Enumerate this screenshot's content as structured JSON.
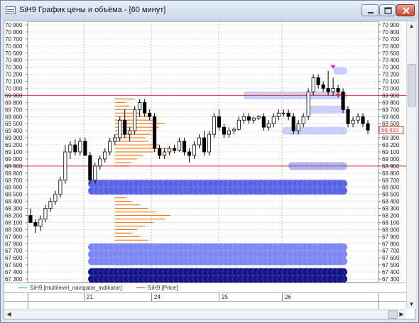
{
  "window": {
    "title": "SiH9 График цены и объёма - [60 минут]",
    "buttons": [
      "minimize",
      "maximize",
      "close"
    ]
  },
  "price_axis": {
    "labels": [
      "70 900",
      "70 800",
      "70 700",
      "70 600",
      "70 500",
      "70 400",
      "70 300",
      "70 200",
      "70 100",
      "70 000",
      "69 900",
      "69 800",
      "69 700",
      "69 600",
      "69 500",
      "69 400",
      "69 300",
      "69 200",
      "69 100",
      "69 000",
      "68 900",
      "68 800",
      "68 700",
      "68 600",
      "68 500",
      "68 400",
      "68 300",
      "68 200",
      "68 100",
      "68 000",
      "67 900",
      "67 800",
      "67 700",
      "67 600",
      "67 500",
      "67 400",
      "67 300"
    ],
    "current_price_label": "69 410",
    "current_price": 69410
  },
  "legend": {
    "items": [
      {
        "label": "SiH9 [multilevel_navigator_indikator]",
        "color": "#2bb3c9"
      },
      {
        "label": "SiH9 [Price]",
        "color": "#d43a2a"
      }
    ]
  },
  "dates": [
    "21",
    "24",
    "25",
    "26"
  ],
  "chart_data": {
    "type": "candlestick",
    "y_range": [
      67250,
      70950
    ],
    "candles": [
      {
        "o": 68200,
        "h": 68300,
        "l": 68100,
        "c": 68100
      },
      {
        "o": 68100,
        "h": 68150,
        "l": 67950,
        "c": 68050
      },
      {
        "o": 68050,
        "h": 68200,
        "l": 67980,
        "c": 68150
      },
      {
        "o": 68150,
        "h": 68350,
        "l": 68100,
        "c": 68300
      },
      {
        "o": 68300,
        "h": 68450,
        "l": 68250,
        "c": 68400
      },
      {
        "o": 68400,
        "h": 68550,
        "l": 68350,
        "c": 68500
      },
      {
        "o": 68500,
        "h": 68750,
        "l": 68450,
        "c": 68700
      },
      {
        "o": 68700,
        "h": 69200,
        "l": 68650,
        "c": 69100
      },
      {
        "o": 69100,
        "h": 69250,
        "l": 69000,
        "c": 69200
      },
      {
        "o": 69200,
        "h": 69280,
        "l": 69050,
        "c": 69100
      },
      {
        "o": 69100,
        "h": 69300,
        "l": 69050,
        "c": 69250
      },
      {
        "o": 69250,
        "h": 69300,
        "l": 69050,
        "c": 69050
      },
      {
        "o": 69050,
        "h": 69100,
        "l": 68650,
        "c": 68700
      },
      {
        "o": 68700,
        "h": 68950,
        "l": 68650,
        "c": 68900
      },
      {
        "o": 68900,
        "h": 69050,
        "l": 68850,
        "c": 69000
      },
      {
        "o": 69000,
        "h": 69150,
        "l": 68950,
        "c": 69100
      },
      {
        "o": 69100,
        "h": 69300,
        "l": 69050,
        "c": 69250
      },
      {
        "o": 69250,
        "h": 69350,
        "l": 69200,
        "c": 69300
      },
      {
        "o": 69300,
        "h": 69600,
        "l": 69250,
        "c": 69550
      },
      {
        "o": 69550,
        "h": 69700,
        "l": 69300,
        "c": 69350
      },
      {
        "o": 69350,
        "h": 69450,
        "l": 69250,
        "c": 69400
      },
      {
        "o": 69400,
        "h": 69750,
        "l": 69350,
        "c": 69700
      },
      {
        "o": 69700,
        "h": 69850,
        "l": 69600,
        "c": 69800
      },
      {
        "o": 69800,
        "h": 69850,
        "l": 69600,
        "c": 69650
      },
      {
        "o": 69650,
        "h": 69700,
        "l": 69550,
        "c": 69600
      },
      {
        "o": 69600,
        "h": 69650,
        "l": 69100,
        "c": 69150
      },
      {
        "o": 69150,
        "h": 69200,
        "l": 69000,
        "c": 69050
      },
      {
        "o": 69050,
        "h": 69150,
        "l": 69000,
        "c": 69100
      },
      {
        "o": 69100,
        "h": 69180,
        "l": 69050,
        "c": 69150
      },
      {
        "o": 69150,
        "h": 69200,
        "l": 69080,
        "c": 69120
      },
      {
        "o": 69120,
        "h": 69300,
        "l": 69100,
        "c": 69250
      },
      {
        "o": 69250,
        "h": 69300,
        "l": 69050,
        "c": 69100
      },
      {
        "o": 69100,
        "h": 69150,
        "l": 68950,
        "c": 69050
      },
      {
        "o": 69050,
        "h": 69250,
        "l": 69000,
        "c": 69200
      },
      {
        "o": 69200,
        "h": 69350,
        "l": 69150,
        "c": 69300
      },
      {
        "o": 69300,
        "h": 69400,
        "l": 69050,
        "c": 69100
      },
      {
        "o": 69100,
        "h": 69400,
        "l": 69050,
        "c": 69350
      },
      {
        "o": 69350,
        "h": 69650,
        "l": 69300,
        "c": 69600
      },
      {
        "o": 69600,
        "h": 69700,
        "l": 69400,
        "c": 69450
      },
      {
        "o": 69450,
        "h": 69500,
        "l": 69300,
        "c": 69350
      },
      {
        "o": 69350,
        "h": 69450,
        "l": 69300,
        "c": 69400
      },
      {
        "o": 69400,
        "h": 69450,
        "l": 69350,
        "c": 69420
      },
      {
        "o": 69420,
        "h": 69600,
        "l": 69400,
        "c": 69550
      },
      {
        "o": 69550,
        "h": 69650,
        "l": 69500,
        "c": 69600
      },
      {
        "o": 69600,
        "h": 69650,
        "l": 69500,
        "c": 69550
      },
      {
        "o": 69550,
        "h": 69600,
        "l": 69500,
        "c": 69580
      },
      {
        "o": 69580,
        "h": 69620,
        "l": 69550,
        "c": 69600
      },
      {
        "o": 69600,
        "h": 69650,
        "l": 69400,
        "c": 69450
      },
      {
        "o": 69450,
        "h": 69550,
        "l": 69400,
        "c": 69500
      },
      {
        "o": 69500,
        "h": 69650,
        "l": 69450,
        "c": 69600
      },
      {
        "o": 69600,
        "h": 69700,
        "l": 69550,
        "c": 69650
      },
      {
        "o": 69650,
        "h": 69700,
        "l": 69600,
        "c": 69650
      },
      {
        "o": 69650,
        "h": 69700,
        "l": 69550,
        "c": 69600
      },
      {
        "o": 69600,
        "h": 69650,
        "l": 69350,
        "c": 69400
      },
      {
        "o": 69400,
        "h": 69550,
        "l": 69350,
        "c": 69500
      },
      {
        "o": 69500,
        "h": 69650,
        "l": 69450,
        "c": 69600
      },
      {
        "o": 69600,
        "h": 70000,
        "l": 69550,
        "c": 69950
      },
      {
        "o": 69950,
        "h": 70200,
        "l": 69900,
        "c": 70150
      },
      {
        "o": 70150,
        "h": 70200,
        "l": 70000,
        "c": 70050
      },
      {
        "o": 70050,
        "h": 70100,
        "l": 69950,
        "c": 70000
      },
      {
        "o": 70000,
        "h": 70250,
        "l": 69900,
        "c": 69950
      },
      {
        "o": 69950,
        "h": 70150,
        "l": 69900,
        "c": 70000
      },
      {
        "o": 70000,
        "h": 70050,
        "l": 69900,
        "c": 69950
      },
      {
        "o": 69950,
        "h": 70000,
        "l": 69650,
        "c": 69700
      },
      {
        "o": 69700,
        "h": 69750,
        "l": 69450,
        "c": 69500
      },
      {
        "o": 69500,
        "h": 69600,
        "l": 69450,
        "c": 69550
      },
      {
        "o": 69550,
        "h": 69650,
        "l": 69500,
        "c": 69600
      },
      {
        "o": 69600,
        "h": 69650,
        "l": 69450,
        "c": 69500
      },
      {
        "o": 69500,
        "h": 69550,
        "l": 69350,
        "c": 69410
      }
    ],
    "horizontal_lines": [
      {
        "price": 69900,
        "color": "#d43a2a"
      },
      {
        "price": 68900,
        "color": "#d43a2a"
      }
    ],
    "levels": [
      {
        "price": 70250,
        "from": 0.86,
        "to": 1.0,
        "color": "#c8ccff"
      },
      {
        "price": 69900,
        "from": 0.58,
        "to": 1.0,
        "color": "#c8ccff"
      },
      {
        "price": 69700,
        "from": 0.78,
        "to": 1.0,
        "color": "#c8ccff"
      },
      {
        "price": 69400,
        "from": 0.7,
        "to": 1.0,
        "color": "#c8ccff"
      },
      {
        "price": 68900,
        "from": 0.72,
        "to": 1.0,
        "color": "#aab2ff"
      },
      {
        "price": 68650,
        "from": 0.2,
        "to": 1.0,
        "color": "#5a63e6"
      },
      {
        "price": 68550,
        "from": 0.2,
        "to": 1.0,
        "color": "#5a63e6"
      },
      {
        "price": 67750,
        "from": 0.2,
        "to": 1.0,
        "color": "#7d86f2"
      },
      {
        "price": 67650,
        "from": 0.2,
        "to": 1.0,
        "color": "#7d86f2"
      },
      {
        "price": 67550,
        "from": 0.2,
        "to": 1.0,
        "color": "#7d86f2"
      },
      {
        "price": 67400,
        "from": 0.2,
        "to": 1.0,
        "color": "#14148a"
      },
      {
        "price": 67300,
        "from": 0.2,
        "to": 1.0,
        "color": "#14148a"
      }
    ],
    "volume_profile": {
      "color": "#f07a1e",
      "rows": [
        {
          "price": 69850,
          "v": 0.35
        },
        {
          "price": 69800,
          "v": 0.2
        },
        {
          "price": 69750,
          "v": 0.25
        },
        {
          "price": 69700,
          "v": 0.3
        },
        {
          "price": 69650,
          "v": 0.45
        },
        {
          "price": 69600,
          "v": 0.6
        },
        {
          "price": 69550,
          "v": 0.75
        },
        {
          "price": 69500,
          "v": 0.9
        },
        {
          "price": 69450,
          "v": 0.8
        },
        {
          "price": 69400,
          "v": 0.7
        },
        {
          "price": 69350,
          "v": 0.65
        },
        {
          "price": 69300,
          "v": 0.55
        },
        {
          "price": 69250,
          "v": 0.6
        },
        {
          "price": 69200,
          "v": 0.8
        },
        {
          "price": 69150,
          "v": 0.95
        },
        {
          "price": 69100,
          "v": 0.7
        },
        {
          "price": 69050,
          "v": 0.5
        },
        {
          "price": 69000,
          "v": 0.4
        },
        {
          "price": 68950,
          "v": 0.3
        },
        {
          "price": 68900,
          "v": 0.25
        },
        {
          "price": 68600,
          "v": 0.2
        },
        {
          "price": 68500,
          "v": 0.15
        },
        {
          "price": 68450,
          "v": 0.2
        },
        {
          "price": 68400,
          "v": 0.3
        },
        {
          "price": 68350,
          "v": 0.45
        },
        {
          "price": 68300,
          "v": 0.6
        },
        {
          "price": 68250,
          "v": 0.75
        },
        {
          "price": 68200,
          "v": 1.0
        },
        {
          "price": 68150,
          "v": 0.9
        },
        {
          "price": 68100,
          "v": 0.7
        },
        {
          "price": 68050,
          "v": 0.55
        },
        {
          "price": 68000,
          "v": 0.4
        },
        {
          "price": 67950,
          "v": 0.3
        },
        {
          "price": 67900,
          "v": 0.45
        },
        {
          "price": 67850,
          "v": 0.6
        },
        {
          "price": 67800,
          "v": 0.75
        },
        {
          "price": 67750,
          "v": 0.9
        },
        {
          "price": 67700,
          "v": 0.8
        },
        {
          "price": 67650,
          "v": 0.65
        },
        {
          "price": 67600,
          "v": 0.5
        },
        {
          "price": 67550,
          "v": 0.35
        },
        {
          "price": 67500,
          "v": 0.25
        }
      ]
    },
    "markers": [
      {
        "type": "triangle-down",
        "index": 61,
        "price": 70290,
        "color": "#e020d8"
      },
      {
        "type": "triangle-down",
        "index": 62,
        "price": 69880,
        "color": "#d43a2a"
      }
    ]
  }
}
